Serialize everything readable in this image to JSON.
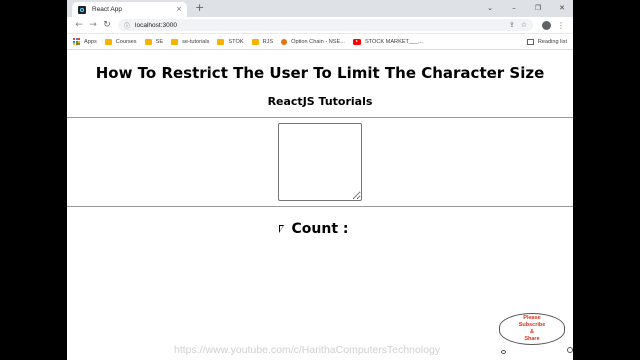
{
  "browser": {
    "tab_title": "React App",
    "tab_close": "×",
    "new_tab": "+",
    "window_controls": [
      "⌄",
      "–",
      "❐",
      "✕"
    ],
    "url": "localhost:3000",
    "bookmarks": [
      {
        "label": "Apps",
        "icon": "apps-grid-icon"
      },
      {
        "label": "Courses",
        "icon": "folder-icon"
      },
      {
        "label": "SE",
        "icon": "folder-icon"
      },
      {
        "label": "se-tutorials",
        "icon": "folder-icon"
      },
      {
        "label": "STOK",
        "icon": "folder-icon"
      },
      {
        "label": "RJS",
        "icon": "folder-icon"
      },
      {
        "label": "Option Chain - NSE...",
        "icon": "option-chain-favicon"
      },
      {
        "label": "STOCK MARKET___...",
        "icon": "youtube-icon"
      }
    ],
    "reading_list": "Reading list"
  },
  "page": {
    "heading": "How To Restrict The User To Limit The Character Size",
    "subheading": "ReactJS Tutorials",
    "textarea_value": "",
    "count_label": "Count :"
  },
  "overlay": {
    "subscribe_text": "Please\nSubscribe\n&\nShare",
    "watermark": "https://www.youtube.com/c/HarithaComputersTechnology"
  },
  "colors": {
    "subscribe_text": "#e0301e",
    "folder": "#f4b400"
  }
}
